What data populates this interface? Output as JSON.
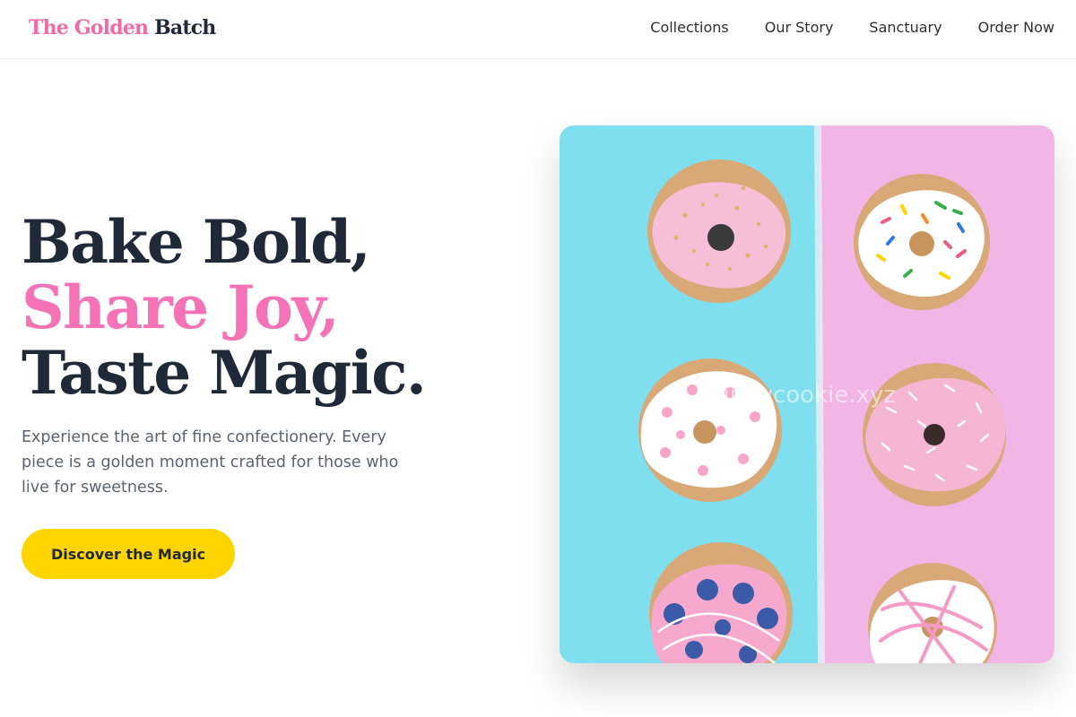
{
  "header": {
    "logo_part1": "The Golden",
    "logo_part2": "Batch",
    "nav": [
      "Collections",
      "Our Story",
      "Sanctuary",
      "Order Now"
    ]
  },
  "hero": {
    "title_line1": "Bake Bold,",
    "title_line2": "Share Joy,",
    "title_line3": "Taste Magic.",
    "description": "Experience the art of fine confectionery. Every piece is a golden moment crafted for those who live for sweetness.",
    "cta_label": "Discover the Magic",
    "image_watermark": "funnycookie.xyz"
  },
  "colors": {
    "accent_pink": "#f472b6",
    "accent_yellow": "#ffd400",
    "text_dark": "#1f2937",
    "image_left_bg": "#7fdfee",
    "image_right_bg": "#f2b6e6"
  }
}
